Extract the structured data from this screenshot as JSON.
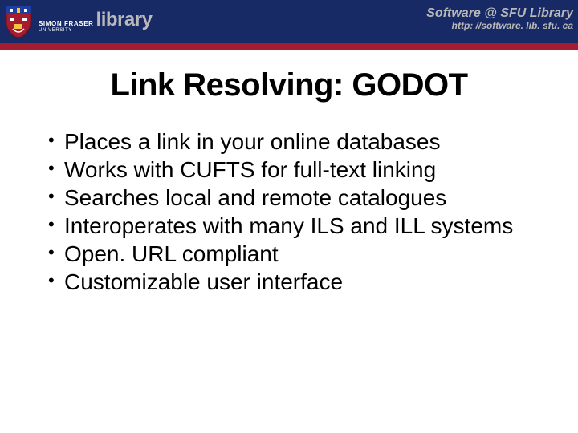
{
  "header": {
    "org_top": "SIMON FRASER",
    "org_bottom": "UNIVERSITY",
    "library_word": "library",
    "right_title": "Software @ SFU Library",
    "right_url": "http: //software. lib. sfu. ca"
  },
  "title": "Link Resolving: GODOT",
  "bullets": [
    "Places a link in your online databases",
    "Works with CUFTS for full-text linking",
    "Searches local and remote catalogues",
    "Interoperates with many ILS and ILL systems",
    "Open. URL compliant",
    "Customizable user interface"
  ]
}
